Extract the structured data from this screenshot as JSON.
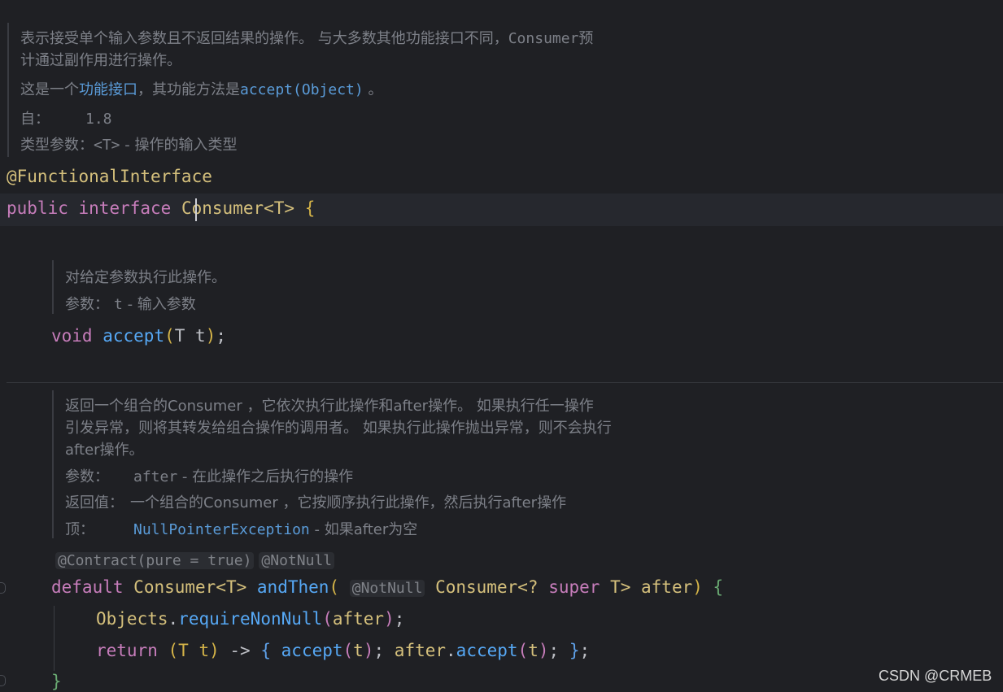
{
  "class_doc": {
    "desc_line1": "表示接受单个输入参数且不返回结果的操作。 与大多数其他功能接口不同，",
    "desc_consumer": "Consumer",
    "desc_tail": "预",
    "desc_line2": "计通过副作用进行操作。",
    "func_prefix": "这是一个",
    "func_link": "功能接口",
    "func_mid": "，其功能方法是",
    "func_method": "accept(Object)",
    "func_end": " 。",
    "since_label": "自：",
    "since_value": "1.8",
    "type_params_label": "类型参数：",
    "type_param": "<T>",
    "type_param_desc": " - 操作的输入类型"
  },
  "code": {
    "annotation": "@FunctionalInterface",
    "kw_public": "public",
    "kw_interface": "interface",
    "class_name": "Consumer<T>",
    "open_brace": "{",
    "accept_doc_line1": "对给定参数执行此操作。",
    "accept_doc_params_label": "参数：",
    "accept_doc_param": "t",
    "accept_doc_param_desc": " - 输入参数",
    "kw_void": "void",
    "accept_name": "accept",
    "accept_args": "T t",
    "semicolon": ";",
    "andthen_doc_line1": "返回一个组合的Consumer ，它依次执行此操作和after操作。 如果执行任一操作",
    "andthen_doc_line2": "引发异常，则将其转发给组合操作的调用者。 如果执行此操作抛出异常，则不会执行",
    "andthen_doc_line3": "after操作。",
    "andthen_params_label": "参数：",
    "andthen_param": "after",
    "andthen_param_desc": " - 在此操作之后执行的操作",
    "andthen_returns_label": "返回值：",
    "andthen_returns": "一个组合的Consumer ，它按顺序执行此操作，然后执行after操作",
    "andthen_throws_label": "顶：",
    "andthen_throws_link": "NullPointerException",
    "andthen_throws_desc": " - 如果after为空",
    "inlay_contract": "@Contract(pure = true)",
    "inlay_notnull": "@NotNull",
    "kw_default": "default",
    "ret_type": "Consumer<T>",
    "andthen_name": "andThen",
    "paren_open": "(",
    "param_inlay_notnull": "@NotNull",
    "param_type_a": "Consumer<?",
    "kw_super": "super",
    "param_type_b": "T>",
    "param_name": "after",
    "paren_close": ")",
    "objects": "Objects",
    "dot": ".",
    "require_non_null": "requireNonNull",
    "arg_after": "after",
    "kw_return": "return",
    "lambda_params": "(T t)",
    "arrow": "->",
    "lambda_open": "{",
    "lambda_accept": "accept",
    "lambda_t": "t",
    "after_obj": "after",
    "lambda_close": "}",
    "method_close": "}"
  },
  "watermark": "CSDN @CRMEB"
}
